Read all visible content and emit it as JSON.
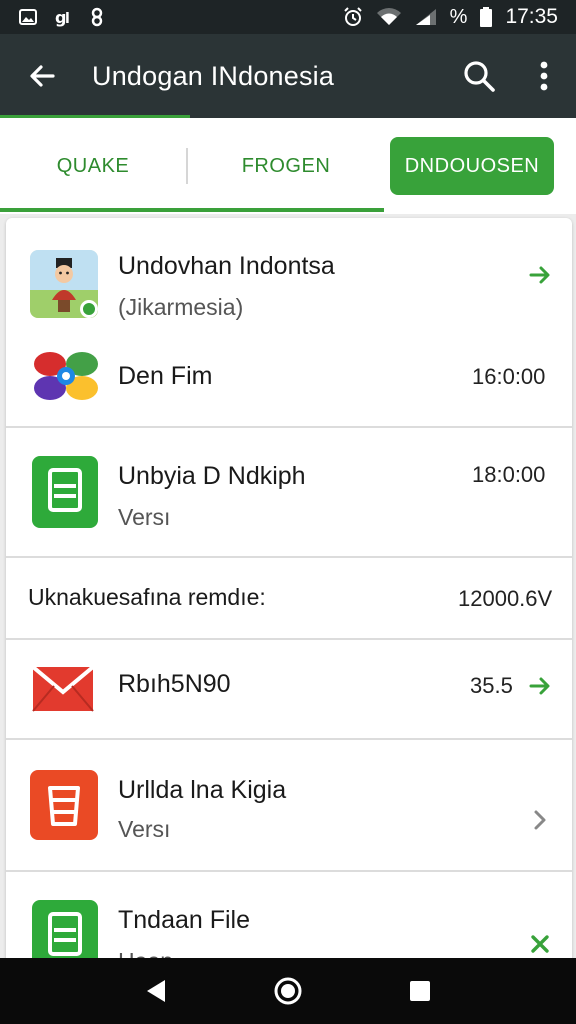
{
  "status_bar": {
    "time": "17:35",
    "battery_text": "%"
  },
  "app_bar": {
    "title": "Undogan INdonesia"
  },
  "tabs": [
    {
      "label": "QUAKE"
    },
    {
      "label": "FROGEN"
    },
    {
      "label": "DNDOUOSEN"
    }
  ],
  "list": [
    {
      "title": "Undovhan Indontsa",
      "subtitle": "(Jikarmesia)",
      "trailing_icon": "arrow-right-icon"
    },
    {
      "title": "Den Fim",
      "value": "16:0:00"
    },
    {
      "title": "Unbyia  D Ndkiph",
      "subtitle": "Versı",
      "value": "18:0:00"
    },
    {
      "title": "Uknakuesafına remdıe:",
      "value": "12000.6V"
    },
    {
      "title": "Rbıh5N90",
      "value": "35.5",
      "trailing_icon": "arrow-right-icon"
    },
    {
      "title": "Urllda lna Kigia",
      "subtitle": "Versı",
      "trailing_icon": "chevron-right-icon"
    },
    {
      "title": "Tndaan File",
      "subtitle": "Haen",
      "trailing_icon": "close-icon"
    }
  ],
  "colors": {
    "accent": "#38a23a",
    "app_bar": "#2b3436",
    "status_bar": "#1e2426",
    "nav_bar": "#0a0a0a"
  }
}
